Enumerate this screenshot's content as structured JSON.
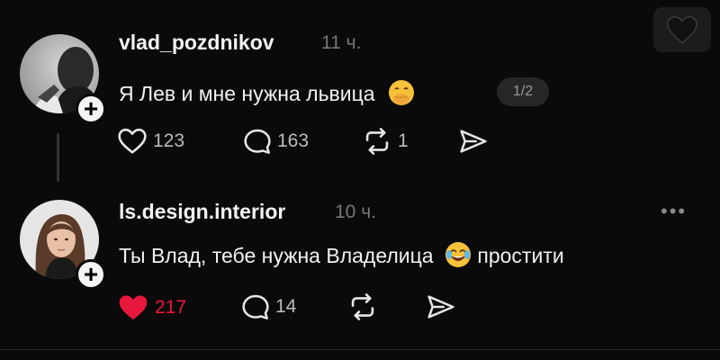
{
  "posts": [
    {
      "username": "vlad_pozdnikov",
      "time": "11 ч.",
      "text": "Я Лев и мне нужна львица",
      "emoji": "face-with-hand-over-mouth",
      "page_indicator": "1/2",
      "likes": "123",
      "comments": "163",
      "reposts": "1",
      "liked": false
    },
    {
      "username": "ls.design.interior",
      "time": "10 ч.",
      "text_before": "Ты Влад, тебе нужна Владелица",
      "emoji": "face-with-tears-of-joy",
      "text_after": "простити",
      "likes": "217",
      "comments": "14",
      "liked": true
    }
  ],
  "colors": {
    "background": "#0a0a0a",
    "liked": "#e8173d",
    "muted": "#777777"
  }
}
